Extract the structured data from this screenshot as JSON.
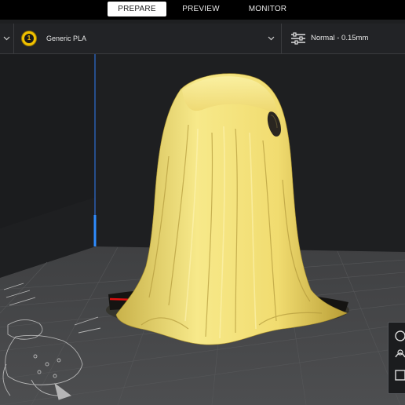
{
  "stages": {
    "prepare": "PREPARE",
    "preview": "PREVIEW",
    "monitor": "MONITOR",
    "active": "prepare"
  },
  "extruder": {
    "number": "1",
    "material": "Generic PLA",
    "color": "#f2c200"
  },
  "profile": {
    "label": "Normal - 0.15mm"
  },
  "colors": {
    "model": "#f3e07a",
    "build_plate": "#4a4b4d",
    "background": "#1e1f21"
  }
}
